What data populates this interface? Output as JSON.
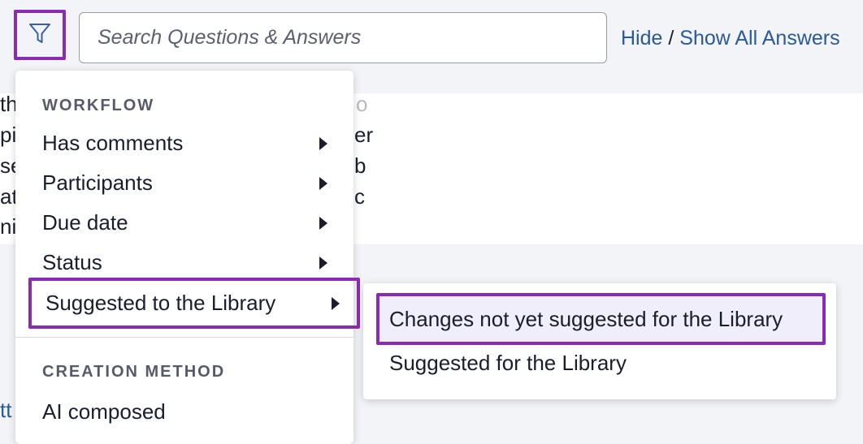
{
  "toolbar": {
    "filter_icon": "filter-funnel-icon",
    "search_placeholder": "Search Questions & Answers",
    "search_value": "",
    "hide_label": "Hide",
    "separator": "/",
    "show_all_label": "Show All Answers"
  },
  "background": {
    "fragments": [
      "th",
      "pi",
      "se",
      "at",
      "ni"
    ],
    "right_fragments": [
      "o",
      "er",
      "b",
      "c"
    ],
    "link_fragment": "tt"
  },
  "filter_menu": {
    "workflow_header": "WORKFLOW",
    "items": [
      {
        "label": "Has comments",
        "has_submenu": true
      },
      {
        "label": "Participants",
        "has_submenu": true
      },
      {
        "label": "Due date",
        "has_submenu": true
      },
      {
        "label": "Status",
        "has_submenu": true
      },
      {
        "label": "Suggested to the Library",
        "has_submenu": true,
        "highlighted": true
      }
    ],
    "creation_header": "CREATION METHOD",
    "creation_items": [
      {
        "label": "AI composed"
      }
    ]
  },
  "submenu": {
    "items": [
      {
        "label": "Changes not yet suggested for the Library",
        "highlighted": true
      },
      {
        "label": "Suggested for the Library"
      }
    ]
  },
  "colors": {
    "highlight_border": "#8a2bb3",
    "link": "#2a5a9a",
    "page_bg": "#f3f4f8",
    "submenu_highlight_bg": "#efeefa"
  }
}
